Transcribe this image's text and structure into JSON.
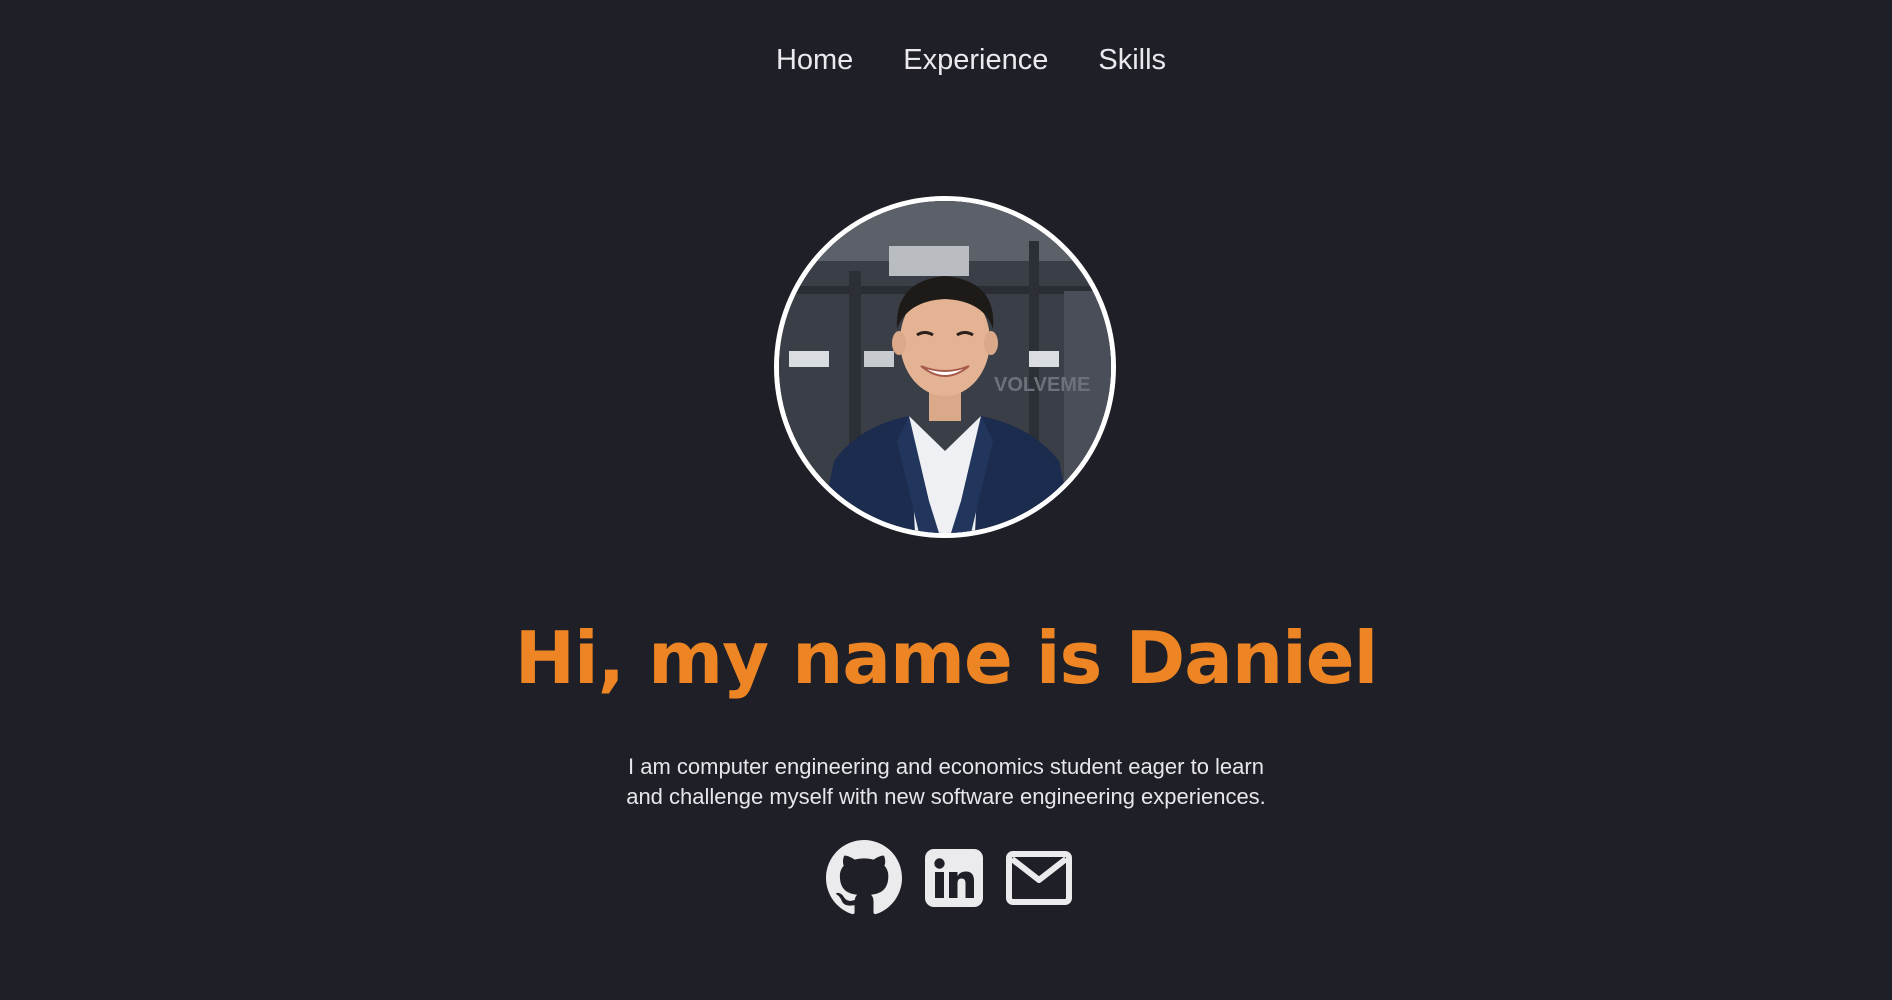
{
  "nav": {
    "items": [
      {
        "label": "Home"
      },
      {
        "label": "Experience"
      },
      {
        "label": "Skills"
      }
    ]
  },
  "hero": {
    "headline": "Hi, my name is Daniel",
    "bio_line1": "I am computer engineering and economics student eager to learn",
    "bio_line2": "and challenge myself with new software engineering experiences.",
    "avatar_sign_text": "VOLVEME"
  },
  "socials": [
    {
      "icon": "github-icon"
    },
    {
      "icon": "linkedin-icon"
    },
    {
      "icon": "mail-icon"
    }
  ],
  "colors": {
    "background": "#1f2027",
    "accent": "#ee8524",
    "text": "#e9e9ee"
  }
}
